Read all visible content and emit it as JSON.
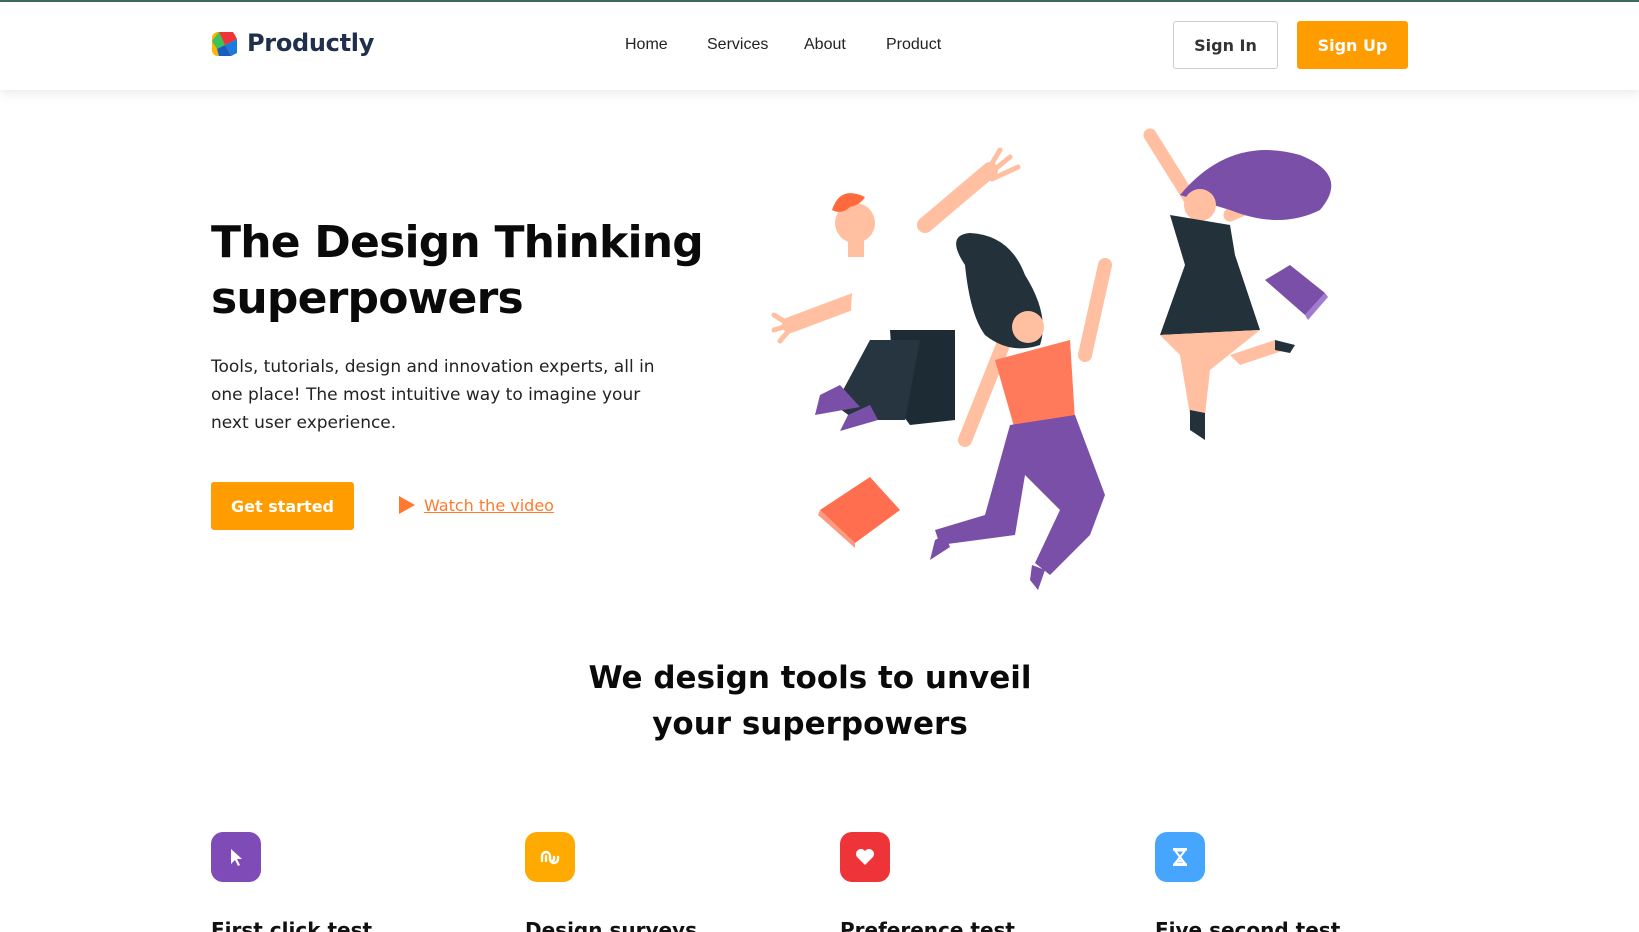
{
  "brand": {
    "name": "Productly",
    "accent": "#ff9d00"
  },
  "nav": {
    "items": [
      {
        "label": "Home"
      },
      {
        "label": "Services"
      },
      {
        "label": "About"
      },
      {
        "label": "Product"
      }
    ],
    "sign_in_label": "Sign In",
    "sign_up_label": "Sign Up"
  },
  "hero": {
    "title_line1": "The Design Thinking",
    "title_line2": "superpowers",
    "description": "Tools, tutorials, design and innovation experts, all in one place! The most intuitive way to imagine your next user experience.",
    "cta_label": "Get started",
    "video_link_label": "Watch the video",
    "video_icon": "play-icon"
  },
  "section": {
    "title_line1": "We design tools to unveil",
    "title_line2": "your superpowers"
  },
  "features": [
    {
      "icon": "cursor-icon",
      "color": "#7f4bb7",
      "title": "First click test"
    },
    {
      "icon": "stumbleupon-icon",
      "color": "#ffaa00",
      "title": "Design surveys"
    },
    {
      "icon": "heart-icon",
      "color": "#ee3339",
      "title": "Preference test"
    },
    {
      "icon": "hourglass-icon",
      "color": "#46a6ff",
      "title": "Five second test"
    }
  ]
}
